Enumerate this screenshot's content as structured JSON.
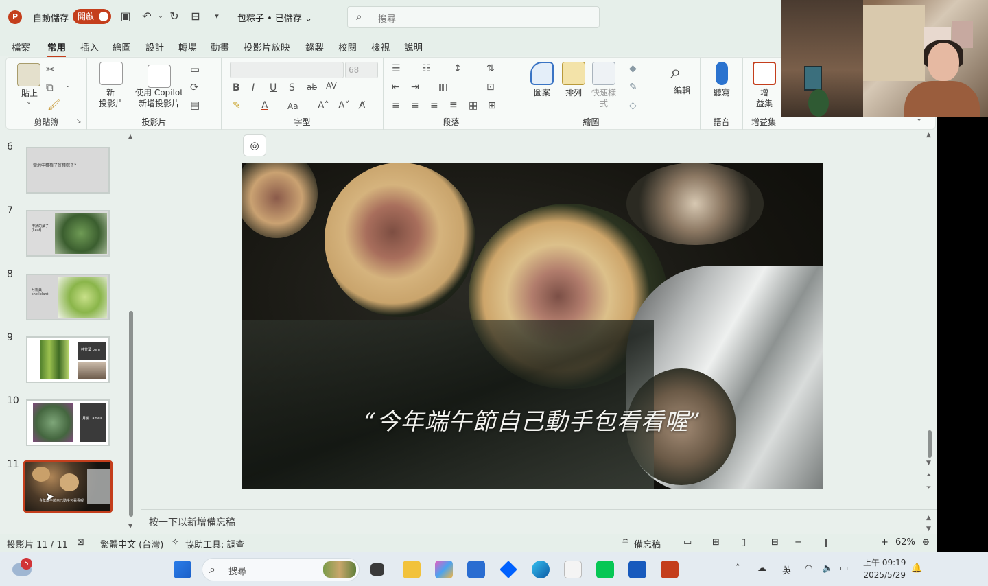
{
  "titlebar": {
    "app_logo": "P",
    "autosave_label": "自動儲存",
    "autosave_state": "開啟",
    "doc_title": "包粽子 • 已儲存",
    "search_placeholder": "搜尋"
  },
  "menu": {
    "tabs": [
      "檔案",
      "常用",
      "插入",
      "繪圖",
      "設計",
      "轉場",
      "動畫",
      "投影片放映",
      "錄製",
      "校閱",
      "檢視",
      "說明"
    ],
    "active": "常用"
  },
  "ribbon": {
    "clipboard": {
      "paste": "貼上",
      "label": "剪貼簿"
    },
    "slides": {
      "new_slide_line1": "新",
      "new_slide_line2": "投影片",
      "copilot_line1": "使用 Copilot",
      "copilot_line2": "新增投影片",
      "label": "投影片"
    },
    "font": {
      "size": "68",
      "label": "字型"
    },
    "paragraph": {
      "label": "段落"
    },
    "drawing": {
      "shapes": "圖案",
      "arrange": "排列",
      "quick_styles_line1": "快速樣",
      "quick_styles_line2": "式",
      "label": "繪圖"
    },
    "editing": {
      "label": "編輯"
    },
    "voice": {
      "dictate": "聽寫",
      "label": "語音"
    },
    "addins": {
      "label_line1": "增",
      "label_line2": "益集",
      "group_label": "增益集"
    }
  },
  "thumbnails": [
    {
      "num": "6",
      "caption": "當地中種植了許種粽子?"
    },
    {
      "num": "7",
      "caption": "申請的葉子 (Leaf)"
    },
    {
      "num": "8",
      "caption": "月桃葉 shellplant"
    },
    {
      "num": "9",
      "caption": "桂竹葉 bam"
    },
    {
      "num": "10",
      "caption": "月桃 Lamell"
    },
    {
      "num": "11",
      "caption": "今年端午節自己動手包看看喔"
    }
  ],
  "slide": {
    "quote": "“今年端午節自己動手包看看喔”"
  },
  "notes_placeholder": "按一下以新增備忘稿",
  "statusbar": {
    "slide_indicator": "投影片 11 / 11",
    "language": "繁體中文 (台灣)",
    "accessibility": "協助工具: 調查",
    "notes": "備忘稿",
    "zoom": "62%"
  },
  "taskbar": {
    "weather_badge": "5",
    "search_placeholder": "搜尋",
    "ime": "英",
    "time": "上午 09:19",
    "date": "2025/5/29"
  },
  "colors": {
    "accent": "#c43e1c",
    "background": "#e9f0ec"
  }
}
